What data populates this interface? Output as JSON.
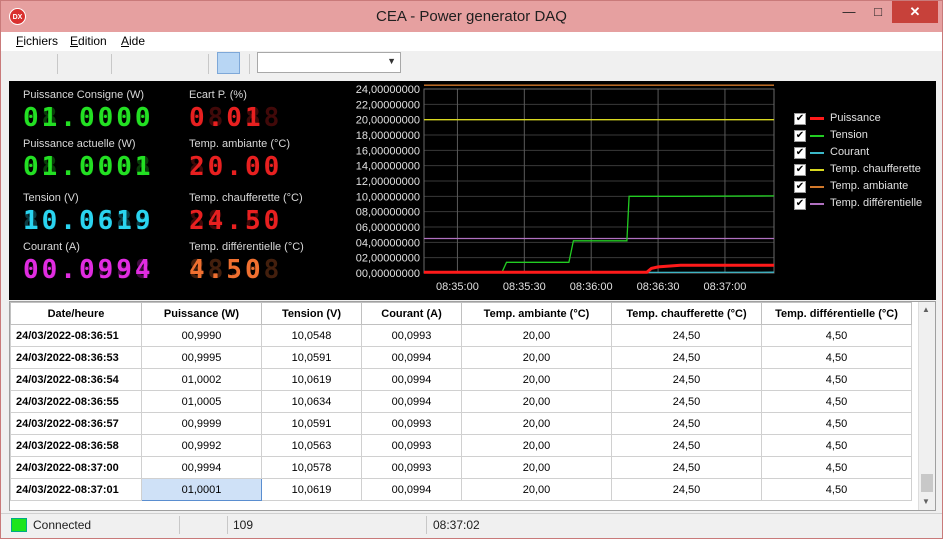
{
  "window": {
    "title": "CEA - Power generator DAQ",
    "icon_text": "DX"
  },
  "menu": [
    {
      "label": "Fichiers",
      "key": "F"
    },
    {
      "label": "Edition",
      "key": "E"
    },
    {
      "label": "Aide",
      "key": "A"
    }
  ],
  "readouts": {
    "left": [
      {
        "label": "Puissance Consigne (W)",
        "value": "01.0000",
        "ghost": "88.8888",
        "color": "#23e023"
      },
      {
        "label": "Puissance actuelle (W)",
        "value": "01.0001",
        "ghost": "88.8888",
        "color": "#23e023"
      },
      {
        "label": "Tension (V)",
        "value": "10.0619",
        "ghost": "88.8888",
        "color": "#2ad4f0"
      },
      {
        "label": "Courant (A)",
        "value": "00.0994",
        "ghost": "88.8888",
        "color": "#e02ce0"
      }
    ],
    "right": [
      {
        "label": "Ecart P. (%)",
        "value": "0.01",
        "ghost": "88.88",
        "color": "#e82020"
      },
      {
        "label": "Temp. ambiante (°C)",
        "value": "20.00",
        "ghost": "88.88",
        "color": "#e82020"
      },
      {
        "label": "Temp. chaufferette (°C)",
        "value": "24.50",
        "ghost": "88.88",
        "color": "#e82020"
      },
      {
        "label": "Temp. différentielle (°C)",
        "value": "4.50",
        "ghost": "88.88",
        "color": "#f07030"
      }
    ]
  },
  "chart_data": {
    "type": "line",
    "y_ticks": [
      "24,00000000",
      "22,00000000",
      "20,00000000",
      "18,00000000",
      "16,00000000",
      "14,00000000",
      "12,00000000",
      "10,00000000",
      "08,00000000",
      "06,00000000",
      "04,00000000",
      "02,00000000",
      "00,00000000"
    ],
    "x_ticks": [
      "08:35:00",
      "08:35:30",
      "08:36:00",
      "08:36:30",
      "08:37:00"
    ],
    "ylim": [
      0,
      24
    ],
    "xlim": [
      -15,
      142
    ],
    "grid": true,
    "legend_placement": "right",
    "series": [
      {
        "name": "Puissance",
        "color": "#ff1a1a",
        "width": 3,
        "x": [
          -15,
          85,
          87,
          90,
          100,
          115,
          142
        ],
        "y": [
          0.1,
          0.1,
          0.6,
          0.8,
          1.0,
          1.0,
          1.0
        ]
      },
      {
        "name": "Tension",
        "color": "#22cc22",
        "width": 1.3,
        "x": [
          -15,
          20,
          22,
          50,
          52,
          76,
          77,
          100,
          142
        ],
        "y": [
          0.1,
          0.1,
          1.4,
          1.4,
          4.2,
          4.2,
          10.0,
          10.0,
          10.06
        ]
      },
      {
        "name": "Courant",
        "color": "#3bb8c8",
        "width": 1.3,
        "x": [
          -15,
          142
        ],
        "y": [
          0.05,
          0.1
        ]
      },
      {
        "name": "Temp. chaufferette",
        "color": "#d8d820",
        "width": 1.3,
        "x": [
          -15,
          142
        ],
        "y": [
          20,
          20
        ]
      },
      {
        "name": "Temp. ambiante",
        "color": "#d2782a",
        "width": 1.3,
        "x": [
          -15,
          142
        ],
        "y": [
          24.5,
          24.5
        ]
      },
      {
        "name": "Temp. différentielle",
        "color": "#b070c0",
        "width": 1.3,
        "x": [
          -15,
          142
        ],
        "y": [
          4.5,
          4.5
        ]
      }
    ]
  },
  "table": {
    "columns": [
      "Date/heure",
      "Puissance (W)",
      "Tension (V)",
      "Courant (A)",
      "Temp. ambiante (°C)",
      "Temp. chaufferette (°C)",
      "Temp. différentielle (°C)"
    ],
    "rows": [
      [
        "24/03/2022-08:36:51",
        "00,9990",
        "10,0548",
        "00,0993",
        "20,00",
        "24,50",
        "4,50"
      ],
      [
        "24/03/2022-08:36:53",
        "00,9995",
        "10,0591",
        "00,0994",
        "20,00",
        "24,50",
        "4,50"
      ],
      [
        "24/03/2022-08:36:54",
        "01,0002",
        "10,0619",
        "00,0994",
        "20,00",
        "24,50",
        "4,50"
      ],
      [
        "24/03/2022-08:36:55",
        "01,0005",
        "10,0634",
        "00,0994",
        "20,00",
        "24,50",
        "4,50"
      ],
      [
        "24/03/2022-08:36:57",
        "00,9999",
        "10,0591",
        "00,0993",
        "20,00",
        "24,50",
        "4,50"
      ],
      [
        "24/03/2022-08:36:58",
        "00,9992",
        "10,0563",
        "00,0993",
        "20,00",
        "24,50",
        "4,50"
      ],
      [
        "24/03/2022-08:37:00",
        "00,9994",
        "10,0578",
        "00,0993",
        "20,00",
        "24,50",
        "4,50"
      ],
      [
        "24/03/2022-08:37:01",
        "01,0001",
        "10,0619",
        "00,0994",
        "20,00",
        "24,50",
        "4,50"
      ]
    ]
  },
  "status": {
    "connection": "Connected",
    "count": "109",
    "time": "08:37:02",
    "led_color": "#1de51d"
  }
}
